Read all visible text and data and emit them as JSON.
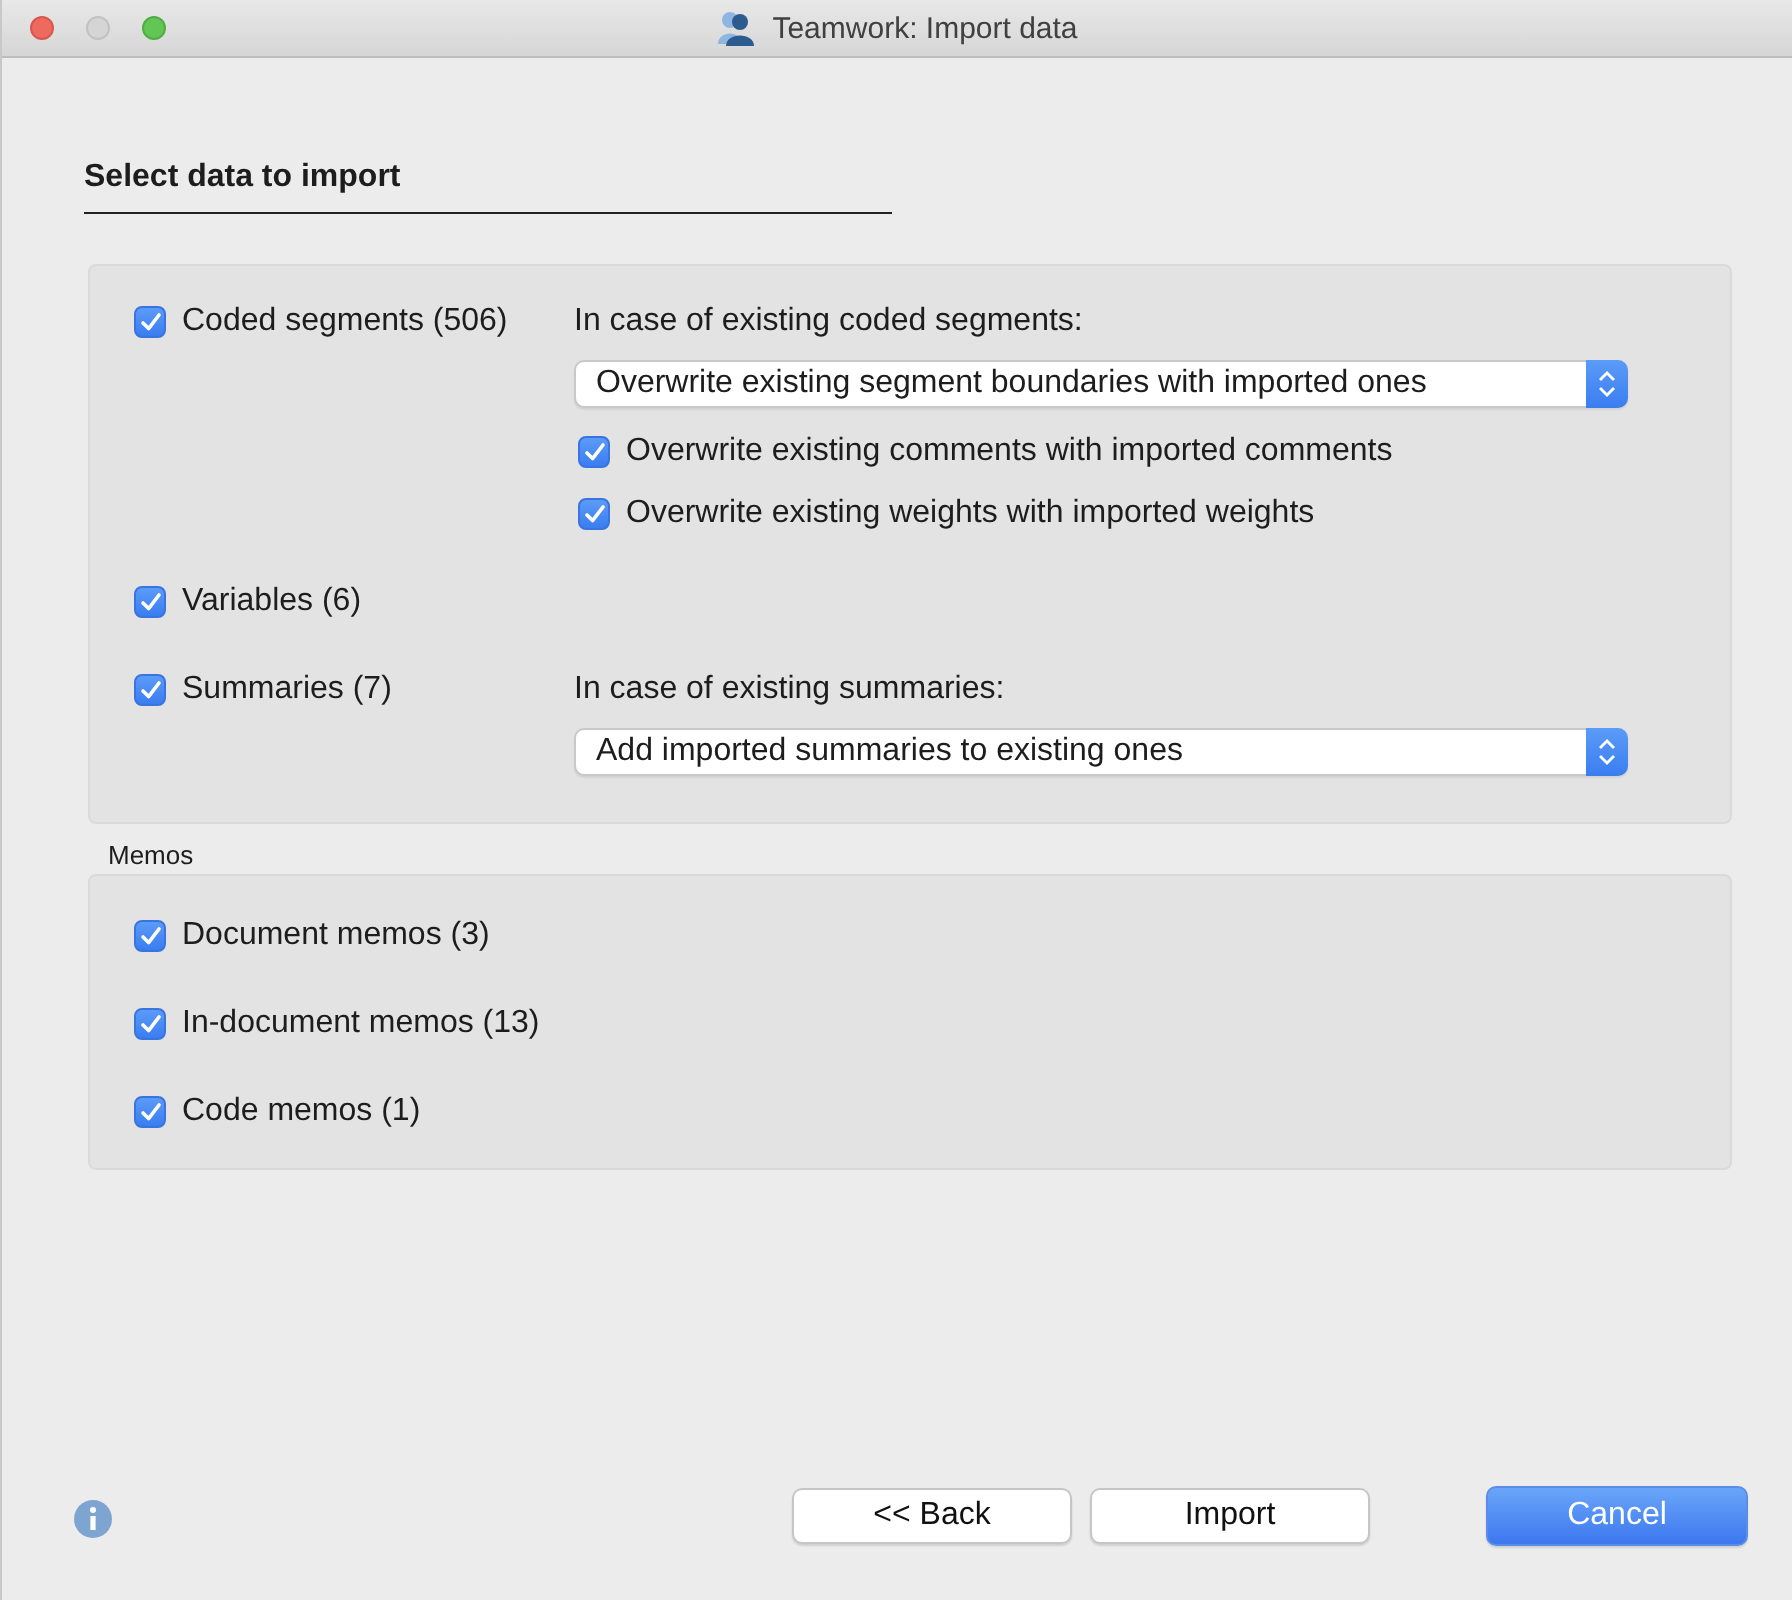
{
  "window": {
    "title": "Teamwork: Import data"
  },
  "heading": "Select data to import",
  "options": [
    {
      "label": "Coded segments (506)",
      "checked": true,
      "prompt": "In case of existing coded segments:",
      "select": "Overwrite existing segment boundaries with imported ones",
      "sub_options": [
        {
          "label": "Overwrite existing comments with imported comments",
          "checked": true
        },
        {
          "label": "Overwrite existing weights with imported weights",
          "checked": true
        }
      ]
    },
    {
      "label": "Variables (6)",
      "checked": true
    },
    {
      "label": "Summaries (7)",
      "checked": true,
      "prompt": "In case of existing summaries:",
      "select": "Add imported summaries to existing ones"
    }
  ],
  "memos": {
    "label": "Memos",
    "options": [
      {
        "label": "Document memos (3)",
        "checked": true
      },
      {
        "label": "In-document memos (13)",
        "checked": true
      },
      {
        "label": "Code memos (1)",
        "checked": true
      }
    ]
  },
  "buttons": [
    {
      "label": "<< Back",
      "kind": "plain"
    },
    {
      "label": "Import",
      "kind": "plain"
    },
    {
      "label": "Cancel",
      "kind": "default"
    }
  ]
}
